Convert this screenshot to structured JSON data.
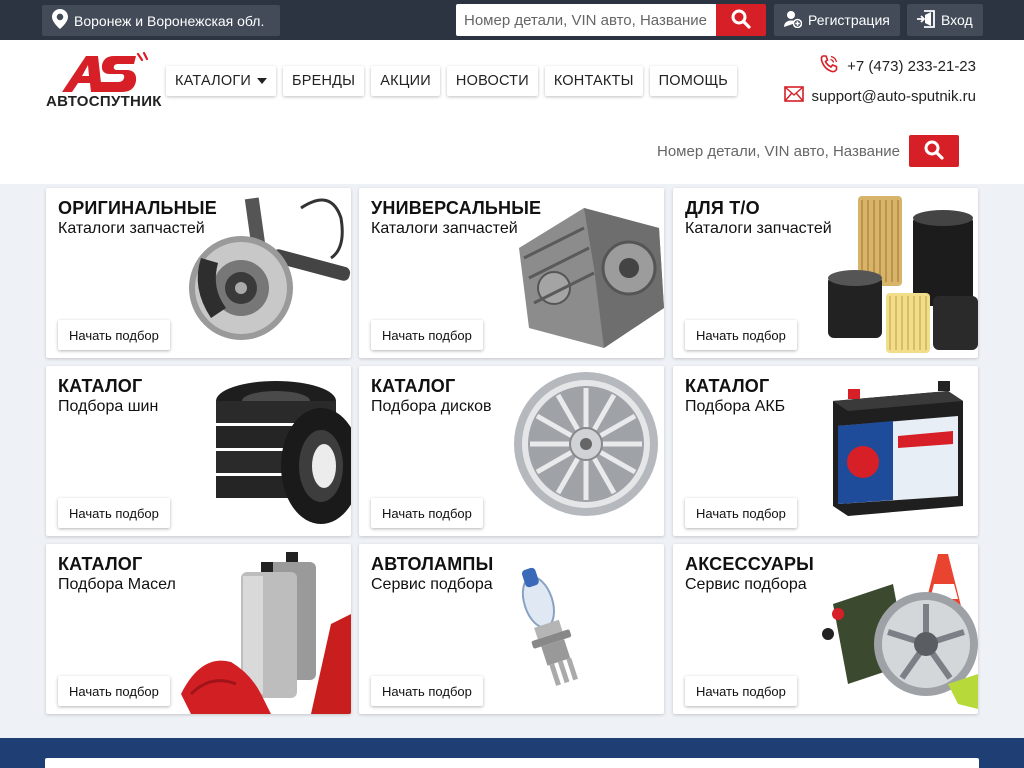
{
  "topbar": {
    "region": "Воронеж и Воронежская обл.",
    "search_placeholder": "Номер детали, VIN авто, Название",
    "register_label": "Регистрация",
    "login_label": "Вход"
  },
  "header": {
    "logo_text": "АВТОСПУТНИК",
    "logo_mark": "AS",
    "nav": [
      {
        "label": "КАТАЛОГИ"
      },
      {
        "label": "БРЕНДЫ"
      },
      {
        "label": "АКЦИИ"
      },
      {
        "label": "НОВОСТИ"
      },
      {
        "label": "КОНТАКТЫ"
      },
      {
        "label": "ПОМОЩЬ"
      }
    ],
    "phone": "+7 (473) 233-21-23",
    "email": "support@auto-sputnik.ru",
    "search_placeholder": "Номер детали, VIN авто, Название"
  },
  "cards": [
    {
      "title": "ОРИГИНАЛЬНЫЕ",
      "subtitle": "Каталоги запчастей",
      "button": "Начать подбор",
      "icon": "brake-disc-icon"
    },
    {
      "title": "УНИВЕРСАЛЬНЫЕ",
      "subtitle": "Каталоги запчастей",
      "button": "Начать подбор",
      "icon": "gearbox-icon"
    },
    {
      "title": "ДЛЯ Т/О",
      "subtitle": "Каталоги запчастей",
      "button": "Начать подбор",
      "icon": "oil-filters-icon"
    },
    {
      "title": "КАТАЛОГ",
      "subtitle": "Подбора шин",
      "button": "Начать подбор",
      "icon": "tires-icon"
    },
    {
      "title": "КАТАЛОГ",
      "subtitle": "Подбора дисков",
      "button": "Начать подбор",
      "icon": "wheel-rim-icon"
    },
    {
      "title": "КАТАЛОГ",
      "subtitle": "Подбора АКБ",
      "button": "Начать подбор",
      "icon": "battery-icon"
    },
    {
      "title": "КАТАЛОГ",
      "subtitle": "Подбора Масел",
      "button": "Начать подбор",
      "icon": "oil-cans-icon"
    },
    {
      "title": "АВТОЛАМПЫ",
      "subtitle": "Сервис подбора",
      "button": "Начать подбор",
      "icon": "headlight-bulb-icon"
    },
    {
      "title": "АКСЕССУАРЫ",
      "subtitle": "Сервис подбора",
      "button": "Начать подбор",
      "icon": "accessories-icon"
    }
  ],
  "colors": {
    "topbar": "#2c3441",
    "accent_red": "#d61f26",
    "footer_band": "#1f3e74"
  }
}
